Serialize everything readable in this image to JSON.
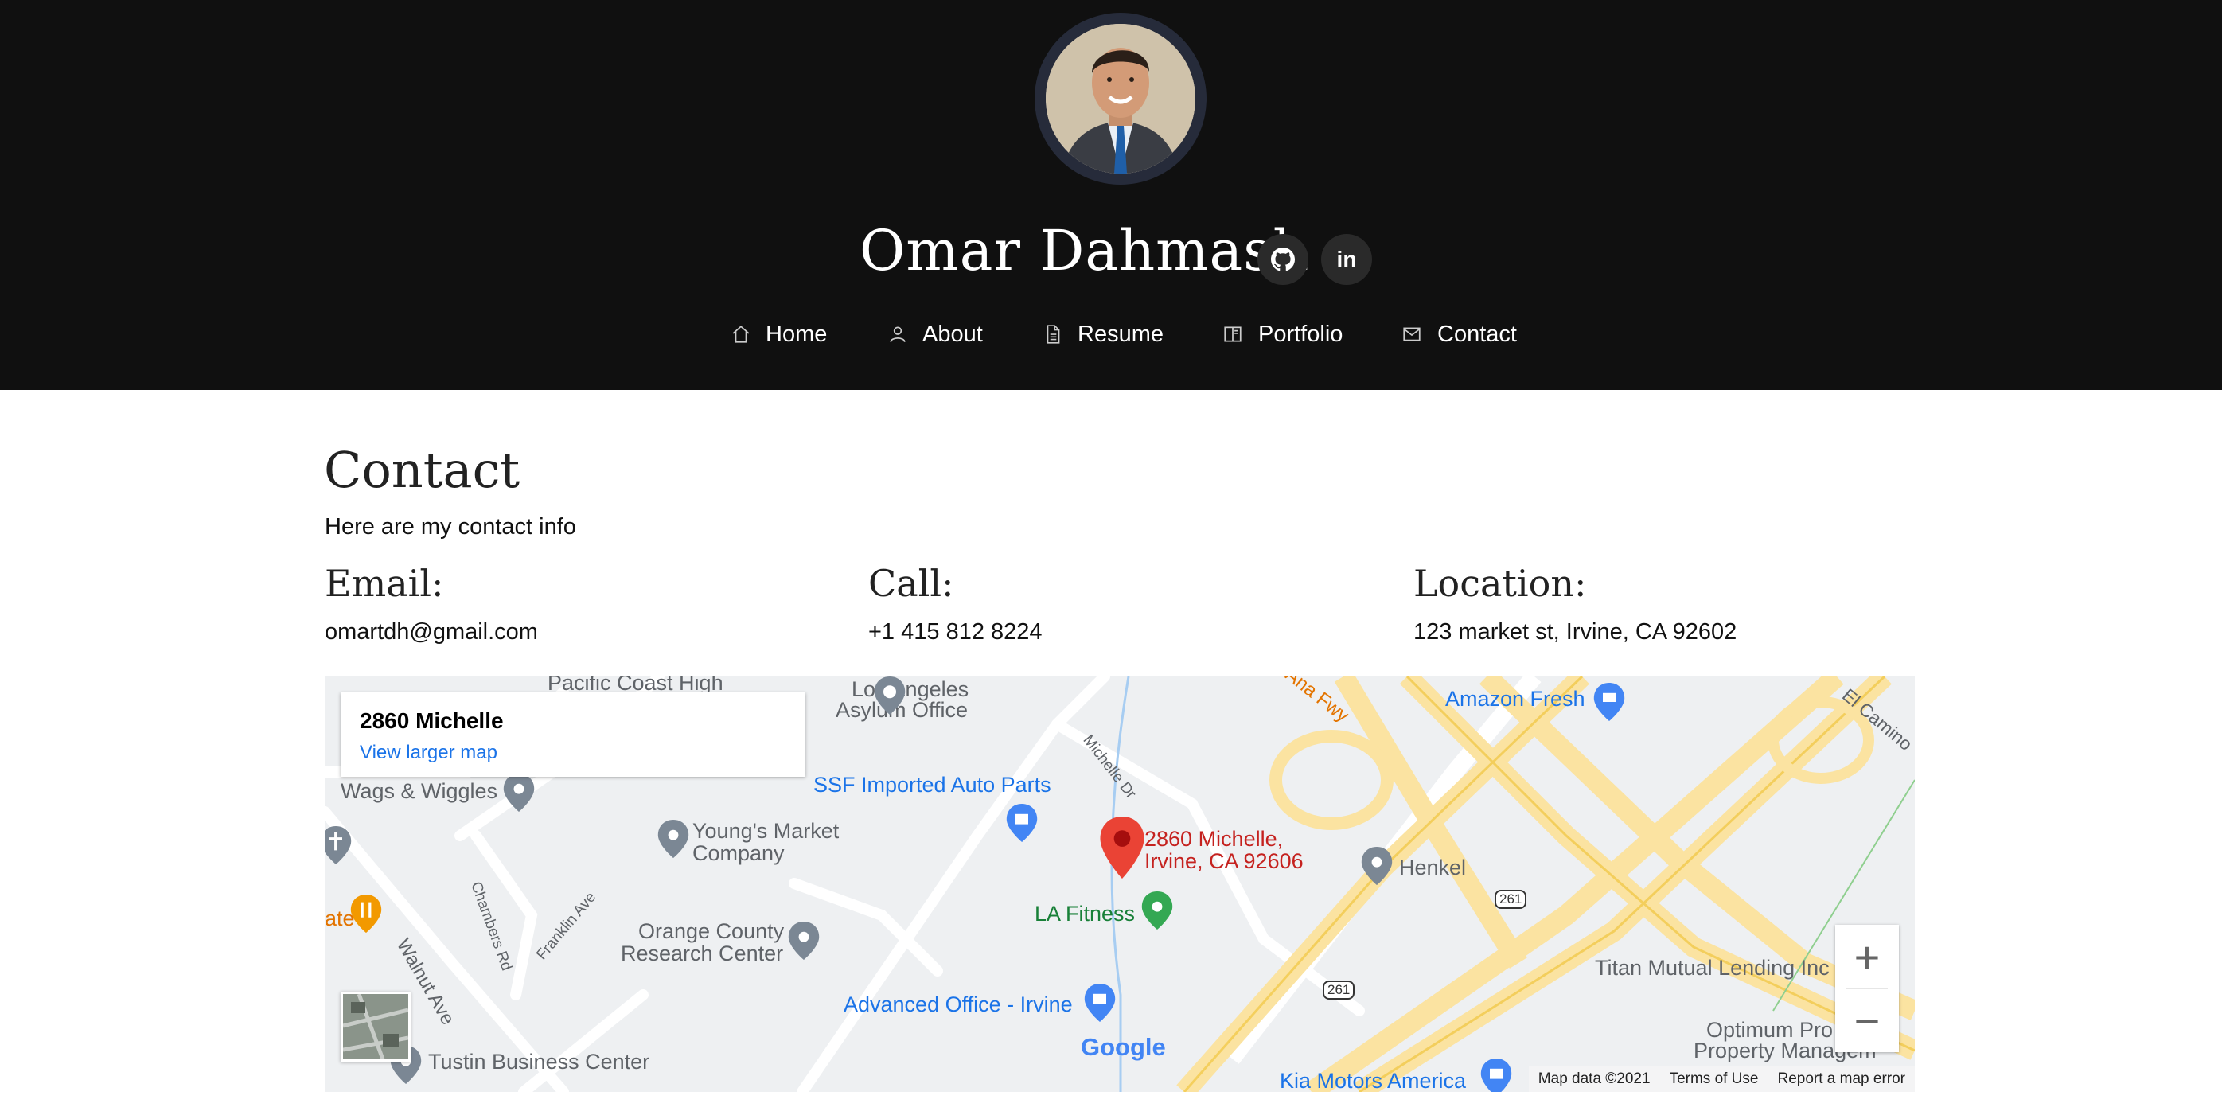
{
  "header": {
    "name": "Omar Dahmash",
    "social": [
      {
        "name": "github-icon"
      },
      {
        "name": "linkedin-icon",
        "label": "in"
      }
    ],
    "nav": [
      {
        "label": "Home",
        "icon": "home-icon"
      },
      {
        "label": "About",
        "icon": "user-icon"
      },
      {
        "label": "Resume",
        "icon": "document-icon"
      },
      {
        "label": "Portfolio",
        "icon": "book-icon"
      },
      {
        "label": "Contact",
        "icon": "envelope-icon"
      }
    ]
  },
  "contact": {
    "title": "Contact",
    "subtitle": "Here are my contact info",
    "email": {
      "heading": "Email:",
      "value": "omartdh@gmail.com"
    },
    "call": {
      "heading": "Call:",
      "value": "+1 415 812 8224"
    },
    "location": {
      "heading": "Location:",
      "value": "123 market st, Irvine, CA 92602"
    }
  },
  "map": {
    "info_title": "2860 Michelle",
    "info_link": "View larger map",
    "labels": {
      "pacific": "Pacific Coast High",
      "la_asylum_1": "Los Angeles",
      "la_asylum_2": "Asylum Office",
      "wags": "Wags & Wiggles",
      "ssf": "SSF Imported Auto Parts",
      "youngs_1": "Young's Market",
      "youngs_2": "Company",
      "pin_1": "2860 Michelle,",
      "pin_2": "Irvine, CA 92606",
      "henkel": "Henkel",
      "la_fitness": "LA Fitness",
      "ocrc_1": "Orange County",
      "ocrc_2": "Research Center",
      "advanced": "Advanced Office - Irvine",
      "tustin": "Tustin Business Center",
      "amazon": "Amazon Fresh",
      "titan": "Titan Mutual Lending Inc",
      "optimum_1": "Optimum Pro",
      "optimum_2": "Property Managem",
      "kia": "Kia Motors America",
      "el_camino": "El Camino",
      "ana_fwy": "Ana Fwy",
      "michelle_dr": "Michelle Dr",
      "chambers": "Chambers Rd",
      "franklin": "Franklin Ave",
      "walnut": "Walnut Ave",
      "ate": "ate",
      "route_261_a": "261",
      "route_261_b": "261",
      "google": "Google"
    },
    "zoom_in": "+",
    "zoom_out": "−",
    "attribution": {
      "data": "Map data ©2021",
      "terms": "Terms of Use",
      "report": "Report a map error"
    }
  }
}
